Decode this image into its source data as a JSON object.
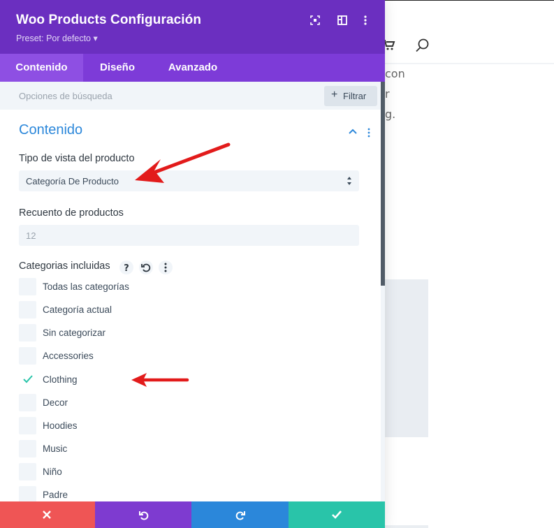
{
  "header": {
    "title": "Woo Products Configuración",
    "preset": "Preset: Por defecto ▾"
  },
  "tabs": [
    {
      "label": "Contenido",
      "active": true
    },
    {
      "label": "Diseño",
      "active": false
    },
    {
      "label": "Avanzado",
      "active": false
    }
  ],
  "search": {
    "placeholder": "Opciones de búsqueda",
    "filter_label": "Filtrar"
  },
  "section": {
    "title": "Contenido"
  },
  "fields": {
    "view_type_label": "Tipo de vista del producto",
    "view_type_value": "Categoría De Producto",
    "count_label": "Recuento de productos",
    "count_value": "12",
    "categories_label": "Categorias incluidas"
  },
  "categories": [
    {
      "label": "Todas las categorías",
      "checked": false
    },
    {
      "label": "Categoría actual",
      "checked": false
    },
    {
      "label": "Sin categorizar",
      "checked": false
    },
    {
      "label": "Accessories",
      "checked": false
    },
    {
      "label": "Clothing",
      "checked": true
    },
    {
      "label": "Decor",
      "checked": false
    },
    {
      "label": "Hoodies",
      "checked": false
    },
    {
      "label": "Music",
      "checked": false
    },
    {
      "label": "Niño",
      "checked": false
    },
    {
      "label": "Padre",
      "checked": false
    }
  ],
  "background_page": {
    "text_lines": [
      "con",
      "r",
      "g."
    ]
  },
  "colors": {
    "header_purple": "#6b2fc0",
    "tab_purple": "#7d3bd8",
    "accent_blue": "#2b87da",
    "footer_red": "#ef5555",
    "footer_purple": "#7e3bd0",
    "footer_blue": "#2b87da",
    "footer_teal": "#29c4a9",
    "annotation_red": "#e21b1b"
  }
}
